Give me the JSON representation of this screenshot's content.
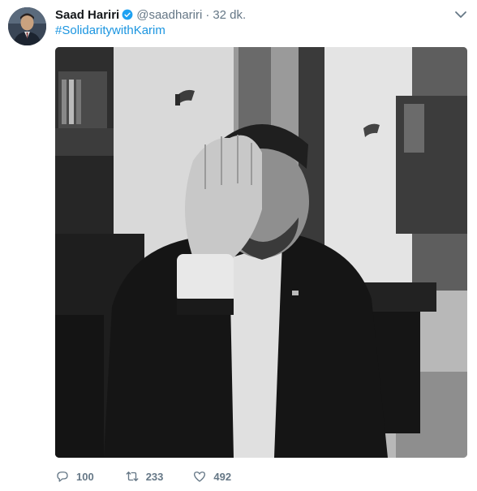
{
  "tweet": {
    "author": {
      "name": "Saad Hariri",
      "handle": "@saadhariri",
      "verified": true
    },
    "separator": "·",
    "timestamp": "32 dk.",
    "text": "#SolidaritywithKarim",
    "media": {
      "style": "black-and-white photo",
      "icon": "photo"
    },
    "actions": {
      "reply_count": "100",
      "retweet_count": "233",
      "like_count": "492"
    }
  },
  "colors": {
    "link": "#1b95e0",
    "secondary_text": "#657786",
    "verified": "#1da1f2"
  }
}
